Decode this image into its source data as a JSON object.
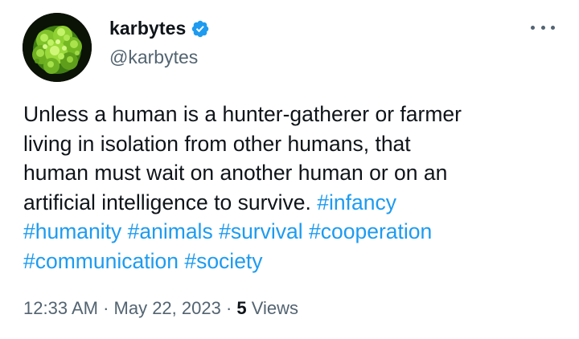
{
  "author": {
    "display_name": "karbytes",
    "handle": "@karbytes",
    "verified": true,
    "avatar_icon": "green-fractal-avatar"
  },
  "more_menu_icon": "ellipsis-icon",
  "tweet": {
    "lines": [
      [
        {
          "text": "Unless a human is a hunter-gatherer or farmer",
          "type": "text"
        }
      ],
      [
        {
          "text": "living in isolation from other humans, that",
          "type": "text"
        }
      ],
      [
        {
          "text": "human must wait on another human or on an",
          "type": "text"
        }
      ],
      [
        {
          "text": "artificial intelligence to survive. ",
          "type": "text"
        },
        {
          "text": "#infancy",
          "type": "hashtag"
        }
      ],
      [
        {
          "text": "#humanity",
          "type": "hashtag"
        },
        {
          "text": " ",
          "type": "text"
        },
        {
          "text": "#animals",
          "type": "hashtag"
        },
        {
          "text": " ",
          "type": "text"
        },
        {
          "text": "#survival",
          "type": "hashtag"
        },
        {
          "text": " ",
          "type": "text"
        },
        {
          "text": "#cooperation",
          "type": "hashtag"
        }
      ],
      [
        {
          "text": "#communication",
          "type": "hashtag"
        },
        {
          "text": " ",
          "type": "text"
        },
        {
          "text": "#society",
          "type": "hashtag"
        }
      ]
    ]
  },
  "meta": {
    "time": "12:33 AM",
    "separator": " · ",
    "date": "May 22, 2023",
    "views_count": "5",
    "views_label": " Views"
  },
  "colors": {
    "hashtag": "#1d9bf0",
    "verified_badge": "#1d9bf0",
    "secondary_text": "#536471",
    "primary_text": "#0f1419"
  }
}
